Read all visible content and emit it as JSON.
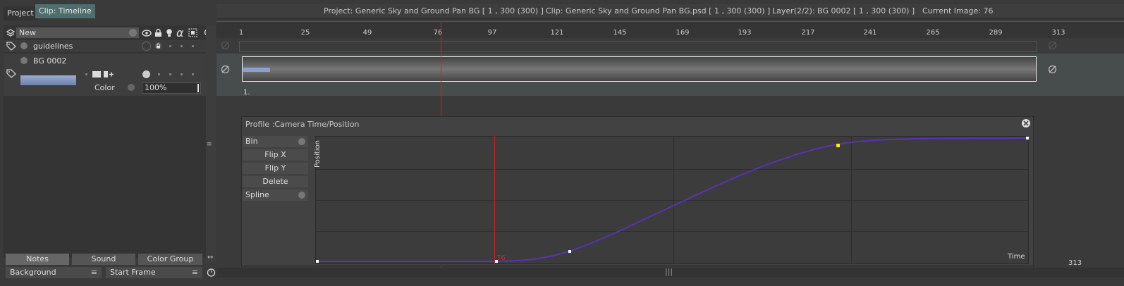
{
  "tabs": [
    {
      "label": "Project"
    },
    {
      "label": "Clip: Timeline"
    }
  ],
  "info_bar": {
    "project": "Project: Generic Sky and Ground Pan BG [ 1 , 300  (300) ]",
    "clip": "Clip: Generic Sky and Ground Pan BG.psd [ 1 , 300  (300) ]",
    "layer": "Layer(2/2): BG 0002 [ 1 , 300  (300) ]",
    "current_image": "Current Image: 76"
  },
  "layers": {
    "new_label": "New",
    "guidelines_label": "guidelines",
    "bg_label": "BG 0002",
    "color_label": "Color",
    "opacity_value": "100%"
  },
  "ruler": {
    "ticks": [
      "1",
      "25",
      "49",
      "76",
      "97",
      "121",
      "145",
      "169",
      "193",
      "217",
      "241",
      "265",
      "289",
      "313"
    ],
    "bottom_end": "313"
  },
  "track": {
    "frame_label": "1."
  },
  "profile": {
    "title": "Profile :Camera Time/Position",
    "bin_label": "Bin",
    "flip_x_label": "Flip X",
    "flip_y_label": "Flip Y",
    "delete_label": "Delete",
    "spline_label": "Spline",
    "y_axis_label": "Position",
    "x_axis_label": "Time",
    "current_frame": "76"
  },
  "bottom": {
    "notes_label": "Notes",
    "sound_label": "Sound",
    "color_group_label": "Color Group",
    "background_label": "Background",
    "start_frame_label": "Start Frame"
  },
  "colors": {
    "playhead": "#d02020",
    "curve": "#5a32b4",
    "keyframe_selected": "#f0f000",
    "accent_tab": "#4e6e6e"
  }
}
